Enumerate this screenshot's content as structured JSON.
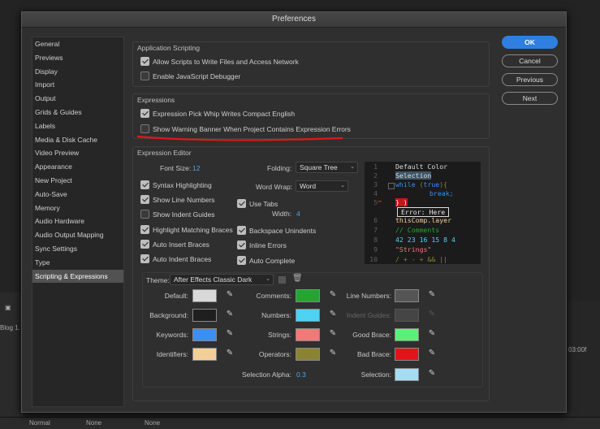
{
  "background_app": {
    "blog_label": "Blog 1.",
    "time_label": "03:00f",
    "mode_normal": "Normal",
    "mode_none1": "None",
    "mode_none2": "None"
  },
  "dialog_title": "Preferences",
  "sidebar": {
    "items": [
      {
        "label": "General"
      },
      {
        "label": "Previews"
      },
      {
        "label": "Display"
      },
      {
        "label": "Import"
      },
      {
        "label": "Output"
      },
      {
        "label": "Grids & Guides"
      },
      {
        "label": "Labels"
      },
      {
        "label": "Media & Disk Cache"
      },
      {
        "label": "Video Preview"
      },
      {
        "label": "Appearance"
      },
      {
        "label": "New Project"
      },
      {
        "label": "Auto-Save"
      },
      {
        "label": "Memory"
      },
      {
        "label": "Audio Hardware"
      },
      {
        "label": "Audio Output Mapping"
      },
      {
        "label": "Sync Settings"
      },
      {
        "label": "Type"
      },
      {
        "label": "Scripting & Expressions",
        "selected": true
      }
    ]
  },
  "buttons": {
    "ok": "OK",
    "cancel": "Cancel",
    "previous": "Previous",
    "next": "Next"
  },
  "app_scripting": {
    "title": "Application Scripting",
    "allow_scripts": {
      "label": "Allow Scripts to Write Files and Access Network",
      "checked": true
    },
    "js_debugger": {
      "label": "Enable JavaScript Debugger",
      "checked": false
    }
  },
  "expressions": {
    "title": "Expressions",
    "pick_whip": {
      "label": "Expression Pick Whip Writes Compact English",
      "checked": true
    },
    "warning_banner": {
      "label": "Show Warning Banner When Project Contains Expression Errors",
      "checked": false
    }
  },
  "expression_editor": {
    "title": "Expression Editor",
    "font_size_label": "Font Size:",
    "font_size": "12",
    "folding_label": "Folding:",
    "folding": "Square Tree",
    "word_wrap_label": "Word Wrap:",
    "word_wrap": "Word",
    "width_label": "Width:",
    "width": "4",
    "syntax": {
      "label": "Syntax Highlighting",
      "checked": true
    },
    "line_numbers": {
      "label": "Show Line Numbers",
      "checked": true
    },
    "indent_guides": {
      "label": "Show Indent Guides",
      "checked": false
    },
    "matching_braces": {
      "label": "Highlight Matching Braces",
      "checked": true
    },
    "auto_insert": {
      "label": "Auto Insert Braces",
      "checked": true
    },
    "auto_indent": {
      "label": "Auto Indent Braces",
      "checked": true
    },
    "use_tabs": {
      "label": "Use Tabs",
      "checked": true
    },
    "backspace": {
      "label": "Backspace Unindents",
      "checked": true
    },
    "inline_errors": {
      "label": "Inline Errors",
      "checked": true
    },
    "auto_complete": {
      "label": "Auto Complete",
      "checked": true
    }
  },
  "code_preview": {
    "line_numbers": [
      "1",
      "2",
      "3",
      "4",
      "5",
      "6",
      "7",
      "8",
      "9",
      "10"
    ],
    "lines": {
      "l1": "Default Color",
      "l2": "Selection",
      "l3a": "while",
      "l3b": " (",
      "l3c": "true",
      "l3d": "){",
      "l4": "break;",
      "l5": "} )",
      "err": "Error: Here",
      "l6": "thisComp.layer",
      "l7": "// Comments",
      "l8": "42 23 16 15 8 4",
      "l9": "\"Strings\"",
      "l10": "/ + - + && ||"
    }
  },
  "theme": {
    "label": "Theme:",
    "value": "After Effects Classic Dark"
  },
  "colors": {
    "default": {
      "label": "Default:",
      "hex": "#d9d9d9"
    },
    "background": {
      "label": "Background:",
      "hex": "#1f1f1f"
    },
    "keywords": {
      "label": "Keywords:",
      "hex": "#3c8ef0"
    },
    "identifiers": {
      "label": "Identifiers:",
      "hex": "#f2cf98"
    },
    "comments": {
      "label": "Comments:",
      "hex": "#25a52f"
    },
    "numbers": {
      "label": "Numbers:",
      "hex": "#4dd2f2"
    },
    "strings": {
      "label": "Strings:",
      "hex": "#ef7b78"
    },
    "operators": {
      "label": "Operators:",
      "hex": "#8b8334"
    },
    "line_numbers": {
      "label": "Line Numbers:",
      "hex": "#555555"
    },
    "indent_guides": {
      "label": "Indent Guides:",
      "hex": "#454545"
    },
    "good_brace": {
      "label": "Good Brace:",
      "hex": "#5cf07a"
    },
    "bad_brace": {
      "label": "Bad Brace:",
      "hex": "#e2141a"
    },
    "selection": {
      "label": "Selection:",
      "hex": "#a6dcf2"
    },
    "selection_alpha_label": "Selection Alpha:",
    "selection_alpha": "0.3"
  }
}
